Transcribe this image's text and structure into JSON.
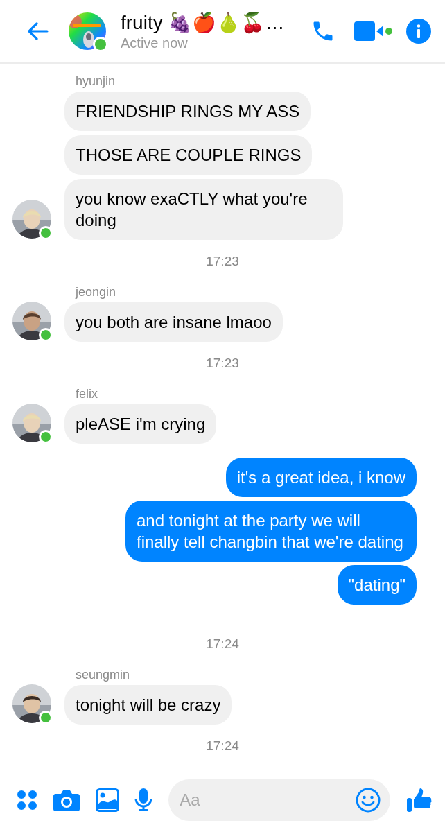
{
  "header": {
    "title": "fruity 🍇🍎🍐🍒…",
    "status": "Active now",
    "online": true,
    "call_online": true
  },
  "messages": [
    {
      "kind": "incoming",
      "sender": "hyunjin",
      "online": true,
      "texts": [
        "FRIENDSHIP RINGS MY ASS",
        "THOSE ARE COUPLE RINGS",
        "you know exaCTLY what you're doing"
      ]
    },
    {
      "kind": "time",
      "text": "17:23"
    },
    {
      "kind": "incoming",
      "sender": "jeongin",
      "online": true,
      "texts": [
        "you both are insane lmaoo"
      ]
    },
    {
      "kind": "time",
      "text": "17:23"
    },
    {
      "kind": "incoming",
      "sender": "felix",
      "online": true,
      "texts": [
        "pleASE i'm crying"
      ]
    },
    {
      "kind": "outgoing",
      "texts": [
        "it's a great idea, i know",
        "and tonight at the party we will finally tell changbin that we're dating",
        "\"dating\""
      ]
    },
    {
      "kind": "time",
      "text": "17:24"
    },
    {
      "kind": "incoming",
      "sender": "seungmin",
      "online": true,
      "texts": [
        "tonight will be crazy"
      ]
    },
    {
      "kind": "time",
      "text": "17:24"
    }
  ],
  "composer": {
    "placeholder": "Aa"
  }
}
